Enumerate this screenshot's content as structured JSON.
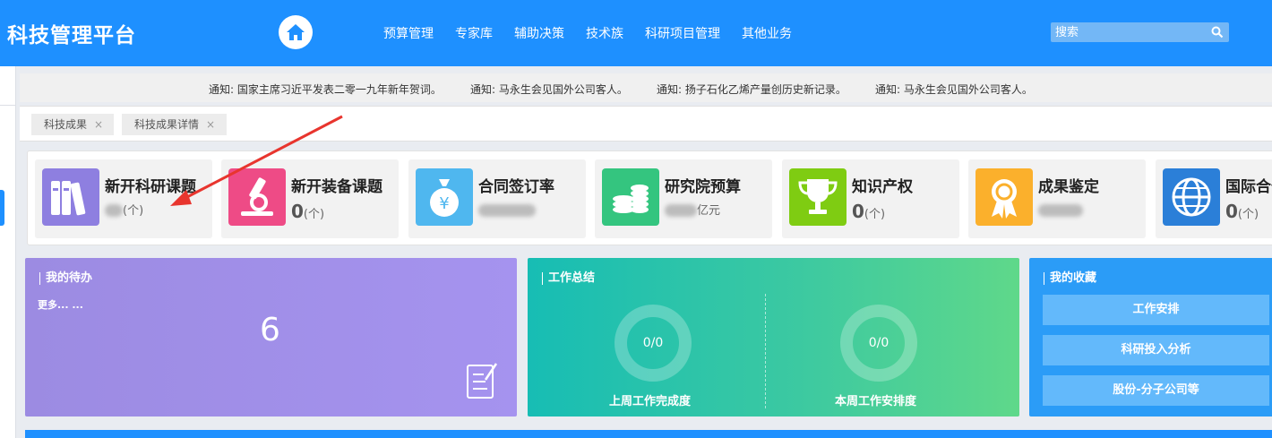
{
  "header": {
    "app_title": "科技管理平台",
    "home_icon": "home-icon",
    "nav": [
      "预算管理",
      "专家库",
      "辅助决策",
      "技术族",
      "科研项目管理",
      "其他业务"
    ],
    "search": {
      "placeholder": "搜索",
      "icon": "search-icon"
    }
  },
  "notices": [
    "通知: 国家主席习近平发表二零一九年新年贺词。",
    "通知: 马永生会见国外公司客人。",
    "通知: 扬子石化乙烯产量创历史新记录。",
    "通知: 马永生会见国外公司客人。"
  ],
  "tabs": [
    {
      "label": "科技成果",
      "close": "×"
    },
    {
      "label": "科技成果详情",
      "close": "×"
    }
  ],
  "stats": [
    {
      "label": "新开科研课题",
      "value": "",
      "unit": "(个)",
      "icon": "books-icon",
      "color": "#8e7fe0"
    },
    {
      "label": "新开装备课题",
      "value": "0",
      "unit": "(个)",
      "icon": "microscope-icon",
      "color": "#ee4b86"
    },
    {
      "label": "合同签订率",
      "value": "",
      "unit": "",
      "icon": "money-bag-icon",
      "color": "#4fb7ef"
    },
    {
      "label": "研究院预算",
      "value": "",
      "unit": "亿元",
      "icon": "coins-icon",
      "color": "#34c57f"
    },
    {
      "label": "知识产权",
      "value": "0",
      "unit": "(个)",
      "icon": "trophy-icon",
      "color": "#7fcc12"
    },
    {
      "label": "成果鉴定",
      "value": "",
      "unit": "",
      "icon": "medal-icon",
      "color": "#fbb02c"
    },
    {
      "label": "国际合作",
      "value": "0",
      "unit": "(个)",
      "icon": "globe-icon",
      "color": "#2b7fd8"
    }
  ],
  "todo": {
    "title": "我的待办",
    "more": "更多... ...",
    "count": "6",
    "icon": "document-edit-icon"
  },
  "summary": {
    "title": "工作总结",
    "left": {
      "value": "0/0",
      "label": "上周工作完成度"
    },
    "right": {
      "value": "0/0",
      "label": "本周工作安排度"
    }
  },
  "favorites": {
    "title": "我的收藏",
    "items": [
      "工作安排",
      "科研投入分析",
      "股份-分子公司等"
    ]
  },
  "colors": {
    "primary": "#1e90ff",
    "todo": "#a593ef",
    "summary": "#3cc9a1",
    "favorites": "#2b9cf7"
  }
}
